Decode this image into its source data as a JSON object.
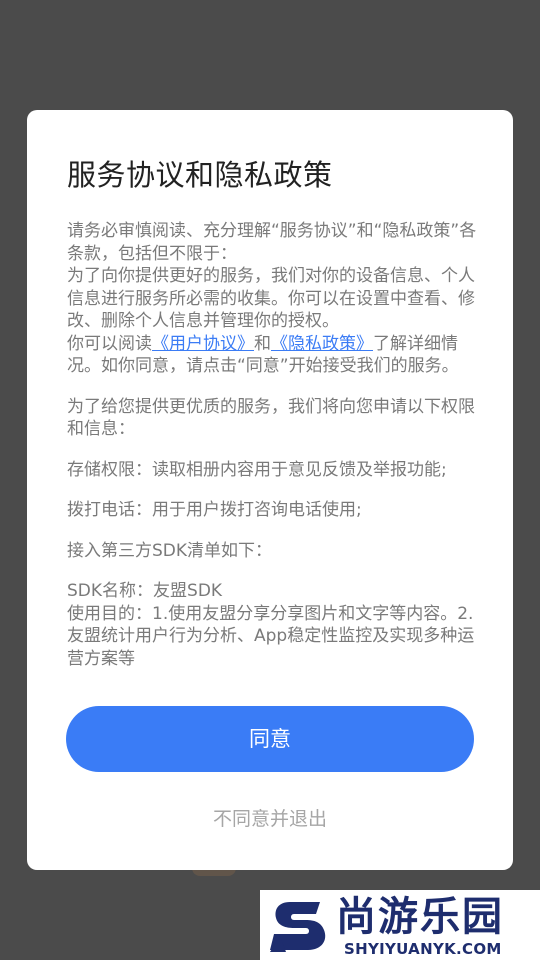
{
  "dialog": {
    "title": "服务协议和隐私政策",
    "intro_1": "请务必审慎阅读、充分理解“服务协议”和“隐私政策”各条款，包括但不限于：",
    "intro_2": "为了向你提供更好的服务，我们对你的设备信息、个人信息进行服务所必需的收集。你可以在设置中查看、修改、删除个人信息并管理你的授权。",
    "read_prefix": "你可以阅读",
    "user_agreement_link": "《用户协议》",
    "read_and": "和",
    "privacy_policy_link": "《隐私政策》",
    "read_suffix": "了解详细情况。如你同意，请点击“同意”开始接受我们的服务。",
    "permissions_intro": "为了给您提供更优质的服务，我们将向您申请以下权限和信息：",
    "storage_permission": "存储权限：读取相册内容用于意见反馈及举报功能;",
    "phone_permission": "拨打电话：用于用户拨打咨询电话使用;",
    "sdk_list_title": "接入第三方SDK清单如下：",
    "sdk_name": "SDK名称：友盟SDK",
    "sdk_purpose": "使用目的：1.使用友盟分享分享图片和文字等内容。2.友盟统计用户行为分析、App稳定性监控及实现多种运营方案等",
    "agree_label": "同意",
    "disagree_label": "不同意并退出"
  },
  "watermark": {
    "brand": "尚游乐园",
    "url": "SHYIYUANYK.COM"
  },
  "colors": {
    "accent": "#3a7cf6",
    "link": "#3b7cf5",
    "overlay": "#4b4b4b",
    "brand_navy": "#1e2d6e"
  }
}
